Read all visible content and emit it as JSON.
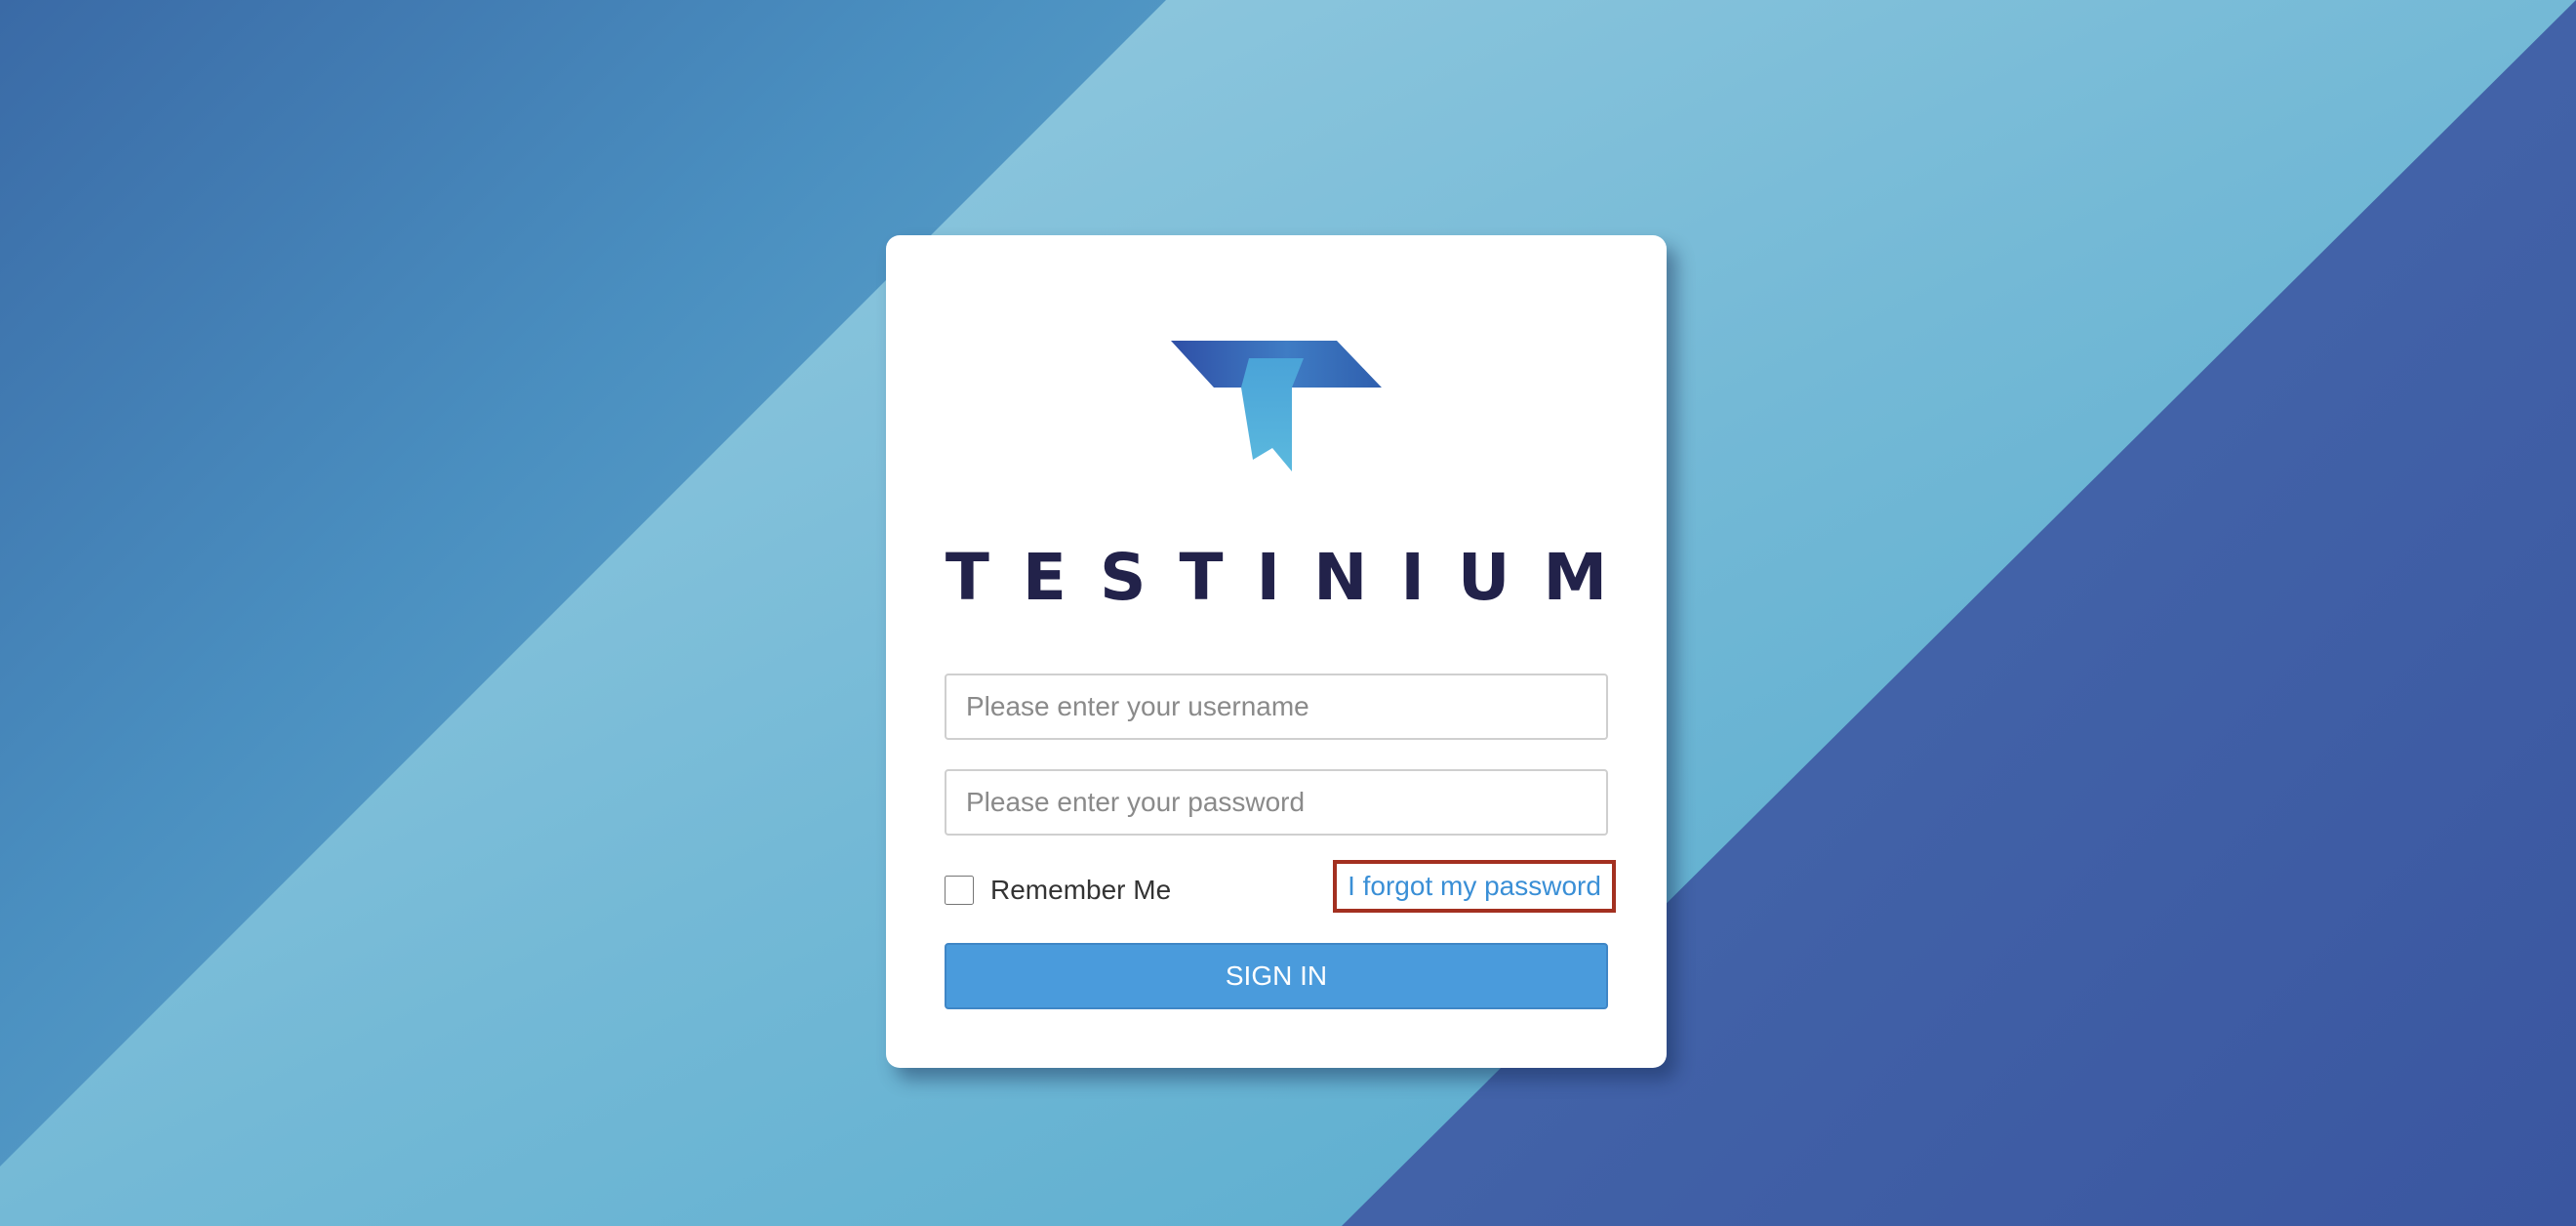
{
  "app": {
    "brand_name": "TESTINIUM",
    "logo_icon": "testinium-t-logo"
  },
  "login_form": {
    "username_placeholder": "Please enter your username",
    "username_value": "",
    "password_placeholder": "Please enter your password",
    "password_value": "",
    "remember_me_label": "Remember Me",
    "remember_me_checked": false,
    "forgot_password_label": "I forgot my password",
    "sign_in_label": "SIGN IN"
  },
  "colors": {
    "brand_text": "#22224a",
    "link": "#3a8fd6",
    "primary_button": "#4a9bdc",
    "highlight_border": "#a33020",
    "bg_dark": "#3a5ea6",
    "bg_light": "#8ec6dc"
  }
}
